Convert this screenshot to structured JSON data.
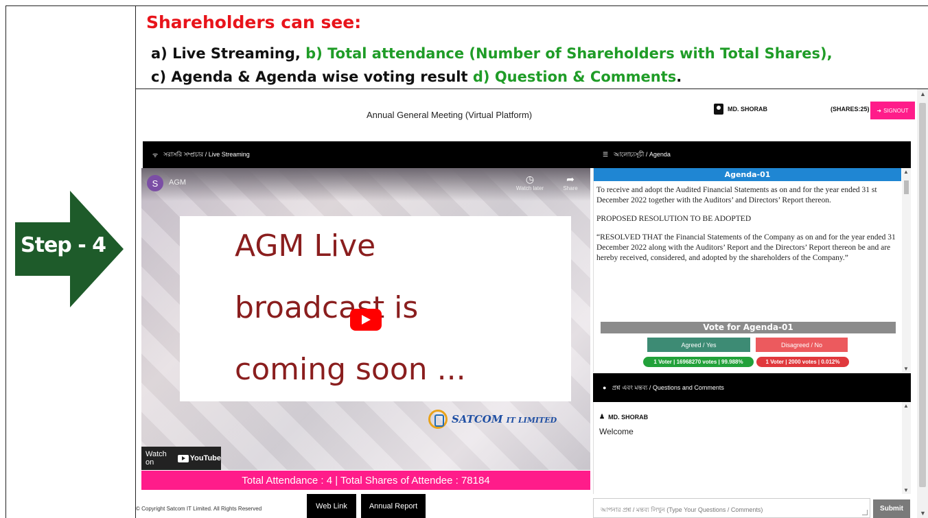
{
  "slide": {
    "step_label": "Step - 4",
    "title": "Shareholders can see:",
    "line1_a": "a) Live Streaming,",
    "line1_b": " b) Total attendance (Number of Shareholders with Total Shares),",
    "line2_a": "c) Agenda & Agenda wise voting result",
    "line2_b": " d) Question & Comments",
    "line2_c": ".",
    "colors": {
      "red": "#e8141b",
      "green": "#1f9c27",
      "arrow": "#1e5b2a"
    }
  },
  "app": {
    "title": "Annual General Meeting (Virtual Platform)",
    "user_name": "MD. SHORAB",
    "shares": "(SHARES:25)",
    "signout_label": "SIGNOUT",
    "accent_pink": "#ff1c8a"
  },
  "live": {
    "bar_label": "সরাসরি সম্প্রচার / Live Streaming",
    "channel_initial": "S",
    "channel_name": "AGM",
    "watch_later": "Watch later",
    "share": "Share",
    "text_line1": "AGM Live",
    "text_line2": "broadcast is",
    "text_line3": "coming soon ...",
    "logo_text": "SATCOM",
    "logo_sub": "IT LIMITED",
    "watch_on": "Watch on",
    "youtube": "YouTube",
    "attendance": "Total Attendance : 4 | Total Shares of Attendee : 78184"
  },
  "agenda": {
    "bar_label": "আলোচ্যসূচী / Agenda",
    "heading": "Agenda-01",
    "para1": "To receive and adopt the Audited Financial Statements as on and for the year ended 31 st December 2022 together with the Auditors’ and Directors’ Report thereon.",
    "para2": "PROPOSED RESOLUTION TO BE ADOPTED",
    "para3": "“RESOLVED THAT the Financial Statements of the Company as on and for the year ended 31 December 2022 along with the Auditors’ Report and the Directors’ Report thereon be and are hereby received, considered, and adopted by the shareholders of the Company.”",
    "vote_heading": "Vote for Agenda-01",
    "agree_label": "Agreed / Yes",
    "disagree_label": "Disagreed / No",
    "agree_result": "1 Voter | 16968270 votes | 99.988%",
    "disagree_result": "1 Voter | 2000 votes | 0.012%"
  },
  "questions": {
    "bar_label": "প্রশ্ন এবং মন্তব্য / Questions and Comments",
    "user": "MD. SHORAB",
    "message": "Welcome",
    "input_placeholder": "আপনার প্রশ্ন / মন্তব্য লিখুন (Type Your Questions / Comments)",
    "submit_label": "Submit"
  },
  "footer": {
    "copyright": "© Copyright Satcom IT Limited. All Rights Reserved",
    "web_link": "Web Link",
    "annual_report": "Annual Report"
  }
}
